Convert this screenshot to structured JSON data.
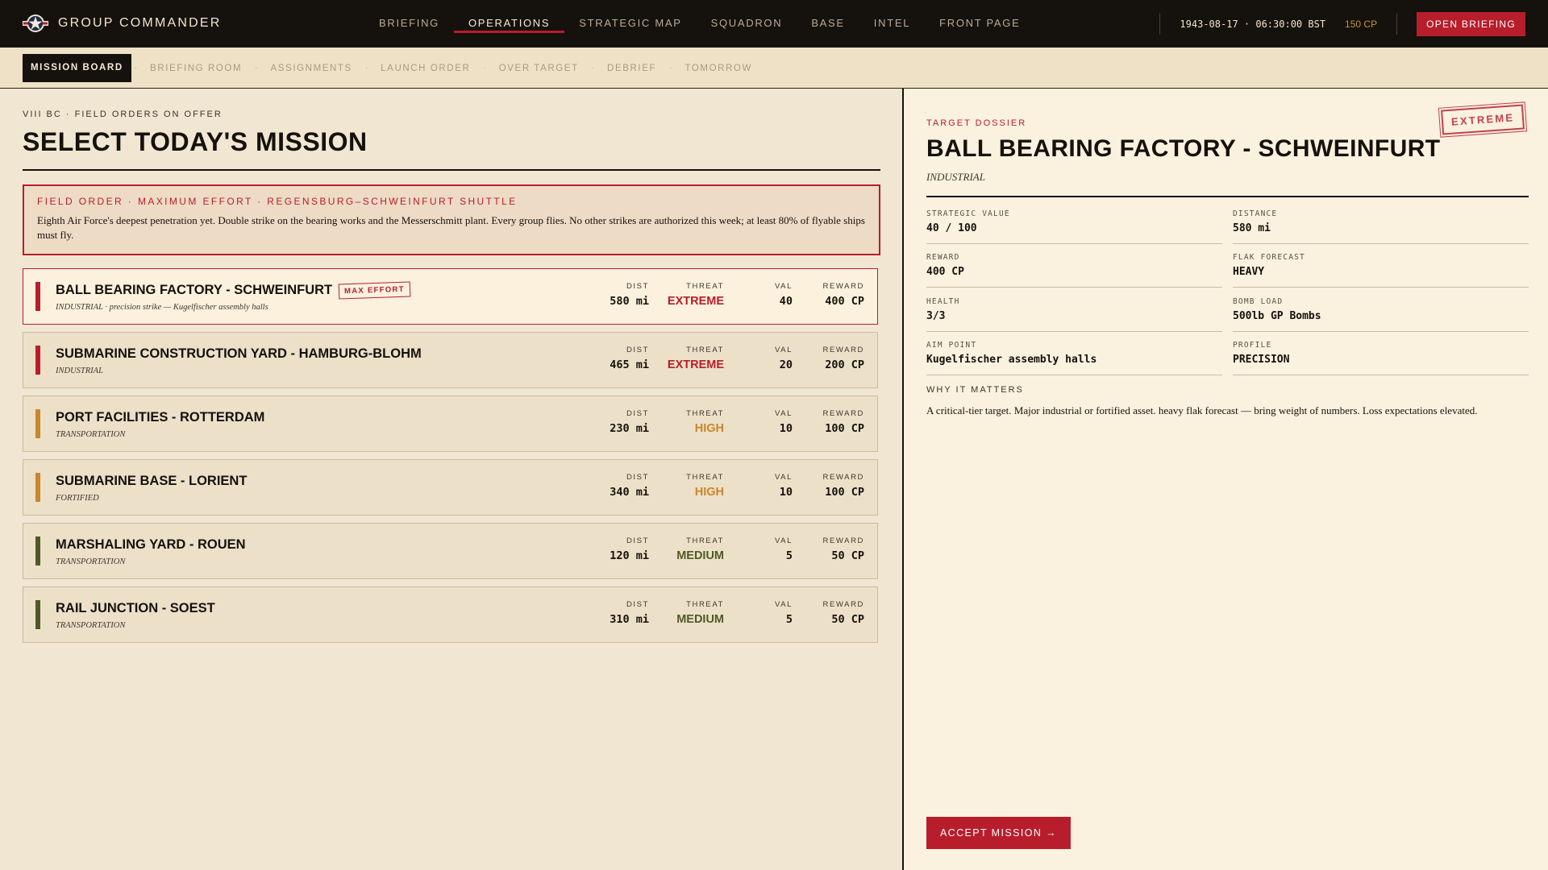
{
  "app": {
    "title": "GROUP COMMANDER",
    "nav": [
      {
        "label": "BRIEFING"
      },
      {
        "label": "OPERATIONS",
        "active": true
      },
      {
        "label": "STRATEGIC MAP"
      },
      {
        "label": "SQUADRON"
      },
      {
        "label": "BASE"
      },
      {
        "label": "INTEL"
      },
      {
        "label": "FRONT PAGE"
      }
    ],
    "datetime": "1943-08-17 · 06:30:00 BST",
    "cp": "150 CP",
    "open_briefing": "OPEN BRIEFING"
  },
  "steps": [
    {
      "label": "MISSION BOARD",
      "active": true
    },
    {
      "label": "BRIEFING ROOM"
    },
    {
      "label": "ASSIGNMENTS"
    },
    {
      "label": "LAUNCH ORDER"
    },
    {
      "label": "OVER TARGET"
    },
    {
      "label": "DEBRIEF"
    },
    {
      "label": "TOMORROW"
    }
  ],
  "board": {
    "kicker": "VIII BC · FIELD ORDERS ON OFFER",
    "title": "SELECT TODAY'S MISSION",
    "field_order": {
      "tag": "FIELD ORDER · MAXIMUM EFFORT · REGENSBURG–SCHWEINFURT SHUTTLE",
      "text": "Eighth Air Force's deepest penetration yet. Double strike on the bearing works and the Messerschmitt plant. Every group flies. No other strikes are authorized this week; at least 80% of flyable ships must fly."
    },
    "labels": {
      "dist": "DIST",
      "threat": "THREAT",
      "val": "VAL",
      "reward": "REWARD"
    },
    "missions": [
      {
        "name": "BALL BEARING FACTORY - SCHWEINFURT",
        "badge": "MAX EFFORT",
        "sub": "INDUSTRIAL · precision strike — Kugelfischer assembly halls",
        "dist": "580 mi",
        "threat": "EXTREME",
        "val": "40",
        "reward": "400 CP",
        "selected": true
      },
      {
        "name": "SUBMARINE CONSTRUCTION YARD - HAMBURG-BLOHM",
        "sub": "INDUSTRIAL",
        "dist": "465 mi",
        "threat": "EXTREME",
        "val": "20",
        "reward": "200 CP"
      },
      {
        "name": "PORT FACILITIES - ROTTERDAM",
        "sub": "TRANSPORTATION",
        "dist": "230 mi",
        "threat": "HIGH",
        "val": "10",
        "reward": "100 CP"
      },
      {
        "name": "SUBMARINE BASE - LORIENT",
        "sub": "FORTIFIED",
        "dist": "340 mi",
        "threat": "HIGH",
        "val": "10",
        "reward": "100 CP"
      },
      {
        "name": "MARSHALING YARD - ROUEN",
        "sub": "TRANSPORTATION",
        "dist": "120 mi",
        "threat": "MEDIUM",
        "val": "5",
        "reward": "50 CP"
      },
      {
        "name": "RAIL JUNCTION - SOEST",
        "sub": "TRANSPORTATION",
        "dist": "310 mi",
        "threat": "MEDIUM",
        "val": "5",
        "reward": "50 CP"
      }
    ]
  },
  "threat_colors": {
    "EXTREME": "#b81d2b",
    "HIGH": "#c8872c",
    "MEDIUM": "#4e5a26"
  },
  "dossier": {
    "kicker": "TARGET DOSSIER",
    "stamp": "EXTREME",
    "title": "BALL BEARING FACTORY - SCHWEINFURT",
    "type": "INDUSTRIAL",
    "facts": [
      {
        "label": "STRATEGIC VALUE",
        "value": "40 / 100"
      },
      {
        "label": "DISTANCE",
        "value": "580 mi"
      },
      {
        "label": "REWARD",
        "value": "400 CP"
      },
      {
        "label": "FLAK FORECAST",
        "value": "HEAVY"
      },
      {
        "label": "HEALTH",
        "value": "3/3"
      },
      {
        "label": "BOMB LOAD",
        "value": "500lb GP Bombs"
      },
      {
        "label": "AIM POINT",
        "value": "Kugelfischer assembly halls"
      },
      {
        "label": "PROFILE",
        "value": "PRECISION"
      }
    ],
    "why_label": "WHY IT MATTERS",
    "why_text": "A critical-tier target. Major industrial or fortified asset. heavy flak forecast — bring weight of numbers. Loss expectations elevated.",
    "accept": "ACCEPT MISSION →"
  }
}
